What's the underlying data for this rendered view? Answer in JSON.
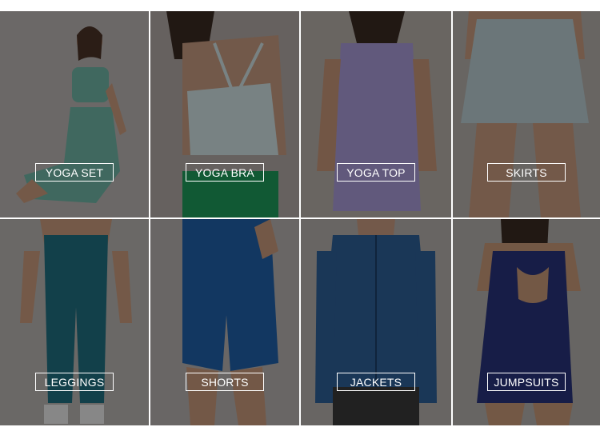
{
  "categories": [
    {
      "label": "YOGA SET",
      "bg": "#b8b4b2",
      "garment": "#6fb3a4",
      "skin": "#c99a7c"
    },
    {
      "label": "YOGA BRA",
      "bg": "#b0a8a4",
      "garment": "#cfe0e2",
      "skin": "#c49a80",
      "accent": "#1e9a5a"
    },
    {
      "label": "YOGA TOP",
      "bg": "#b6aea8",
      "garment": "#a89ad6",
      "skin": "#c59478"
    },
    {
      "label": "SKIRTS",
      "bg": "#b4aeaa",
      "garment": "#b8ccd0",
      "skin": "#c79a7e"
    },
    {
      "label": "LEGGINGS",
      "bg": "#b7b3b0",
      "garment": "#1f6f80",
      "skin": "#c89a7c"
    },
    {
      "label": "SHORTS",
      "bg": "#b5b0ae",
      "garment": "#1f5fa8",
      "skin": "#c7987b"
    },
    {
      "label": "JACKETS",
      "bg": "#b3aeab",
      "garment": "#2e5f96",
      "skin": "#c69a80"
    },
    {
      "label": "JUMPSUITS",
      "bg": "#b2aeab",
      "garment": "#28337a",
      "skin": "#c69878"
    }
  ]
}
